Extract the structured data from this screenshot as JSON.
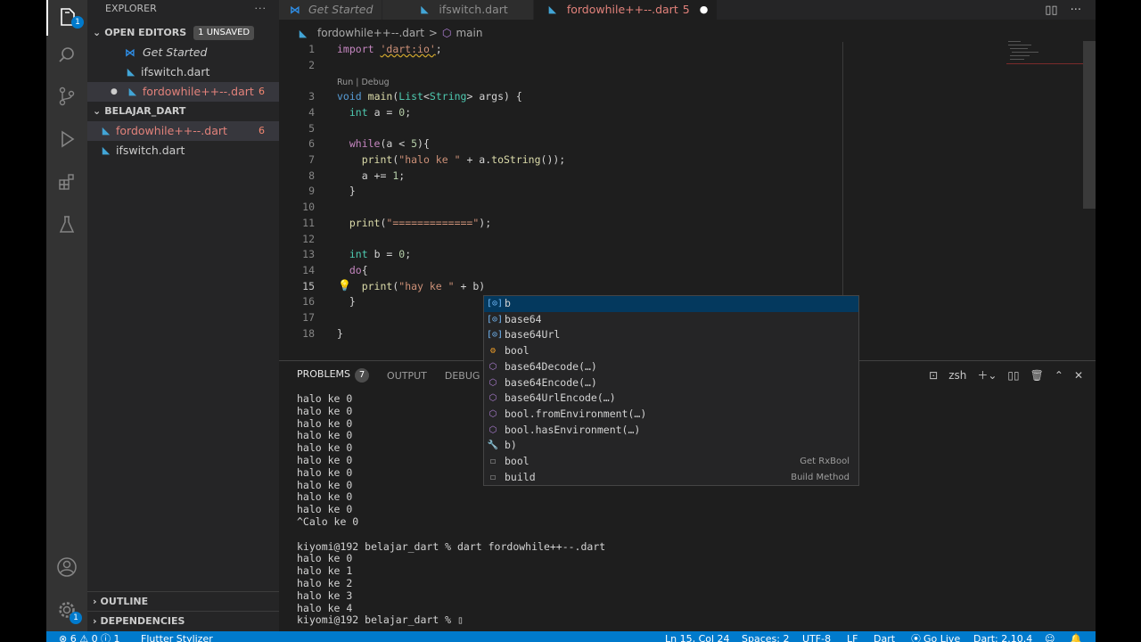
{
  "activity": {
    "explorer_badge": "1",
    "settings_badge": "1"
  },
  "sidebar": {
    "title": "EXPLORER",
    "more": "···",
    "open_editors": {
      "label": "OPEN EDITORS",
      "badge": "1 UNSAVED"
    },
    "open_files": [
      {
        "name": "Get Started",
        "count": ""
      },
      {
        "name": "ifswitch.dart",
        "count": ""
      },
      {
        "name": "fordowhile++--.dart",
        "count": "6"
      }
    ],
    "project": {
      "label": "BELAJAR_DART"
    },
    "project_files": [
      {
        "name": "fordowhile++--.dart",
        "count": "6"
      },
      {
        "name": "ifswitch.dart",
        "count": ""
      }
    ],
    "outline": "OUTLINE",
    "dependencies": "DEPENDENCIES"
  },
  "tabs": [
    {
      "label": "Get Started"
    },
    {
      "label": "ifswitch.dart"
    },
    {
      "label": "fordowhile++--.dart",
      "count": "5"
    }
  ],
  "breadcrumb": {
    "file": "fordowhile++--.dart",
    "sep": ">",
    "symbol": "main"
  },
  "editor": {
    "line_numbers": [
      "1",
      "2",
      "3",
      "4",
      "5",
      "6",
      "7",
      "8",
      "9",
      "10",
      "11",
      "12",
      "13",
      "14",
      "15",
      "16",
      "17",
      "18"
    ],
    "codelens": "Run | Debug",
    "lines": {
      "l1_kw": "import",
      "l1_str": "'dart:io'",
      "l1_end": ";",
      "l3_kw": "void",
      "l3_fn": "main",
      "l3_a": "(",
      "l3_ty": "List",
      "l3_b": "<",
      "l3_ty2": "String",
      "l3_c": "> args) {",
      "l4_kw": "int",
      "l4_a": " a = ",
      "l4_num": "0",
      "l4_end": ";",
      "l6_kw": "while",
      "l6_a": "(a < ",
      "l6_num": "5",
      "l6_end": "){",
      "l7_fn": "print",
      "l7_a": "(",
      "l7_str": "\"halo ke \"",
      "l7_b": " + a.",
      "l7_fn2": "toString",
      "l7_end": "());",
      "l8_a": "a += ",
      "l8_num": "1",
      "l8_end": ";",
      "l9": "}",
      "l11_fn": "print",
      "l11_a": "(",
      "l11_str": "\"=============\"",
      "l11_end": ");",
      "l13_kw": "int",
      "l13_a": " b = ",
      "l13_num": "0",
      "l13_end": ";",
      "l14_kw": "do",
      "l14_end": "{",
      "l15_fn": "print",
      "l15_a": "(",
      "l15_str": "\"hay ke \"",
      "l15_b": " + b)",
      "l16": "}",
      "l18": "}"
    }
  },
  "suggestions": [
    {
      "label": "b",
      "kind": "variable",
      "detail": ""
    },
    {
      "label": "base64",
      "kind": "variable",
      "detail": ""
    },
    {
      "label": "base64Url",
      "kind": "variable",
      "detail": ""
    },
    {
      "label": "bool",
      "kind": "class",
      "detail": ""
    },
    {
      "label": "base64Decode(…)",
      "kind": "method",
      "detail": ""
    },
    {
      "label": "base64Encode(…)",
      "kind": "method",
      "detail": ""
    },
    {
      "label": "base64UrlEncode(…)",
      "kind": "method",
      "detail": ""
    },
    {
      "label": "bool.fromEnvironment(…)",
      "kind": "method",
      "detail": ""
    },
    {
      "label": "bool.hasEnvironment(…)",
      "kind": "method",
      "detail": ""
    },
    {
      "label": "b)",
      "kind": "snippet",
      "detail": ""
    },
    {
      "label": "bool",
      "kind": "text",
      "detail": "Get RxBool"
    },
    {
      "label": "build",
      "kind": "text",
      "detail": "Build Method"
    }
  ],
  "panel": {
    "problems": "PROBLEMS",
    "problems_count": "7",
    "output": "OUTPUT",
    "debug": "DEBUG",
    "shell": "zsh",
    "terminal_lines": [
      "halo ke 0",
      "halo ke 0",
      "halo ke 0",
      "halo ke 0",
      "halo ke 0",
      "halo ke 0",
      "halo ke 0",
      "halo ke 0",
      "halo ke 0",
      "halo ke 0",
      "^Calo ke 0",
      "",
      "kiyomi@192 belajar_dart % dart fordowhile++--.dart",
      "halo ke 0",
      "halo ke 1",
      "halo ke 2",
      "halo ke 3",
      "halo ke 4",
      "kiyomi@192 belajar_dart % ▯"
    ]
  },
  "status": {
    "errors": "⊗ 6 ⚠ 0 ⓘ 1",
    "flutter": "Flutter Stylizer",
    "position": "Ln 15, Col 24",
    "spaces": "Spaces: 2",
    "encoding": "UTF-8",
    "eol": "LF",
    "language": "Dart",
    "golive": "Go Live",
    "sdk": "Dart: 2.10.4"
  }
}
